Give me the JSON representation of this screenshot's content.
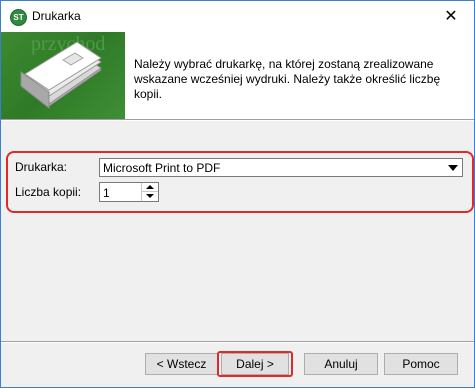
{
  "window": {
    "title": "Drukarka",
    "app_icon_text": "ST",
    "close_glyph": "✕"
  },
  "header": {
    "description": "Należy wybrać drukarkę, na której zostaną zrealizowane wskazane wcześniej wydruki. Należy także określić liczbę kopii.",
    "banner_watermark": "przychod"
  },
  "form": {
    "printer_label": "Drukarka:",
    "printer_value": "Microsoft Print to PDF",
    "copies_label": "Liczba kopii:",
    "copies_value": "1"
  },
  "buttons": {
    "back": "< Wstecz",
    "next": "Dalej >",
    "cancel": "Anuluj",
    "help": "Pomoc"
  },
  "colors": {
    "highlight": "#e02a2a",
    "banner_green": "#3d8a31",
    "window_border": "#3b7fd0"
  }
}
